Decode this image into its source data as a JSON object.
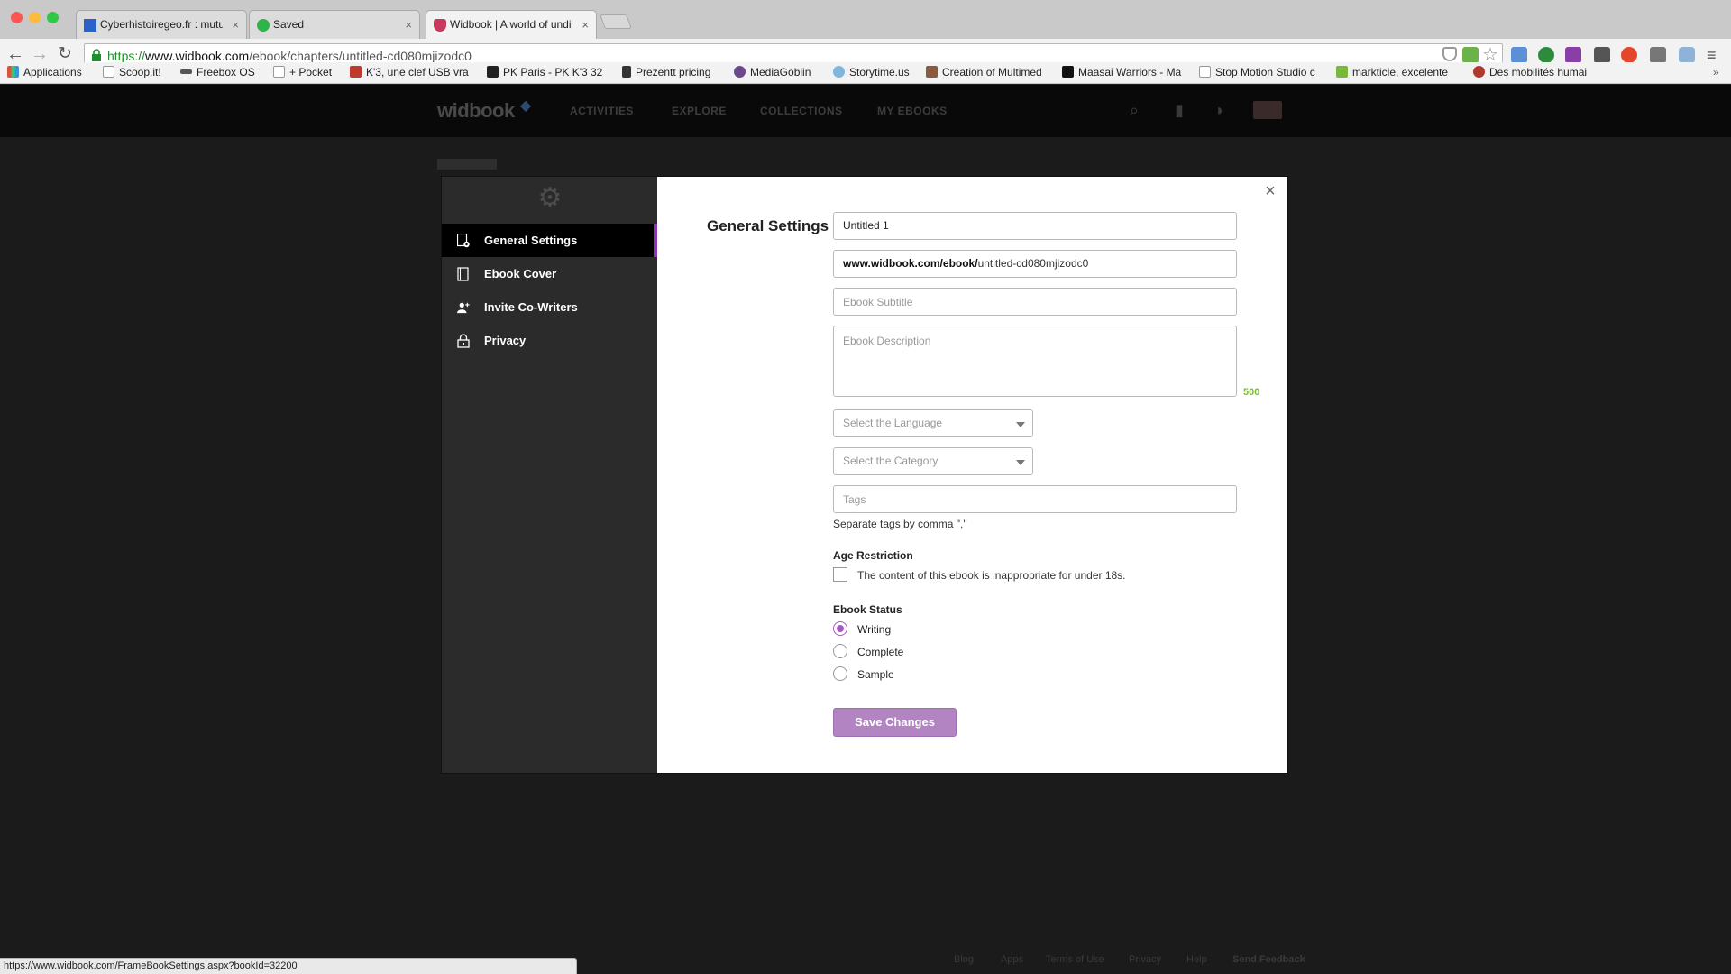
{
  "browser": {
    "tabs": [
      {
        "title": "Cyberhistoiregeo.fr : mutua",
        "favicon_color": "#2a62c9"
      },
      {
        "title": "Saved",
        "favicon_color": "#2fb44a"
      },
      {
        "title": "Widbook | A world of undis",
        "favicon_color": "#c73a5d"
      }
    ],
    "url": {
      "scheme": "https://",
      "host": "www.widbook.com",
      "path": "/ebook/chapters/untitled-cd080mjizodc0"
    },
    "bookmarks": [
      "Applications",
      "Scoop.it!",
      "Freebox OS",
      "+ Pocket",
      "K'3, une clef USB vra",
      "PK Paris - PK K'3 32",
      "Prezentt pricing",
      "MediaGoblin",
      "Storytime.us",
      "Creation of Multimed",
      "Maasai Warriors - Ma",
      "Stop Motion Studio c",
      "markticle, excelente",
      "Des mobilités humai"
    ],
    "status_url": "https://www.widbook.com/FrameBookSettings.aspx?bookId=32200"
  },
  "site": {
    "logo": "widbook",
    "nav": [
      "ACTIVITIES",
      "EXPLORE",
      "COLLECTIONS",
      "MY EBOOKS"
    ],
    "footer_links": [
      "Blog",
      "Apps",
      "Terms of Use",
      "Privacy",
      "Help",
      "Send Feedback"
    ]
  },
  "modal": {
    "sidebar": [
      {
        "label": "General Settings",
        "icon": "settings-doc-icon",
        "active": true
      },
      {
        "label": "Ebook Cover",
        "icon": "book-icon",
        "active": false
      },
      {
        "label": "Invite Co-Writers",
        "icon": "add-user-icon",
        "active": false
      },
      {
        "label": "Privacy",
        "icon": "lock-icon",
        "active": false
      }
    ],
    "title": "General Settings",
    "close_label": "×",
    "ebook_title": "Untitled 1",
    "url_prefix": "www.widbook.com/ebook/",
    "url_slug": "untitled-cd080mjizodc0",
    "subtitle_placeholder": "Ebook Subtitle",
    "description_placeholder": "Ebook Description",
    "description_counter": "500",
    "language_placeholder": "Select the Language",
    "category_placeholder": "Select the Category",
    "tags_placeholder": "Tags",
    "tags_hint": "Separate tags by comma \",\"",
    "age_restriction": {
      "label": "Age Restriction",
      "checkbox_label": "The content of this ebook is inappropriate for under 18s.",
      "checked": false
    },
    "status": {
      "label": "Ebook Status",
      "options": [
        "Writing",
        "Complete",
        "Sample"
      ],
      "selected": "Writing"
    },
    "save_label": "Save Changes"
  },
  "colors": {
    "accent": "#a45bc1",
    "save_button": "#b285c2",
    "counter": "#7dbd2a",
    "sidebar_bg": "#2b2b2b"
  }
}
